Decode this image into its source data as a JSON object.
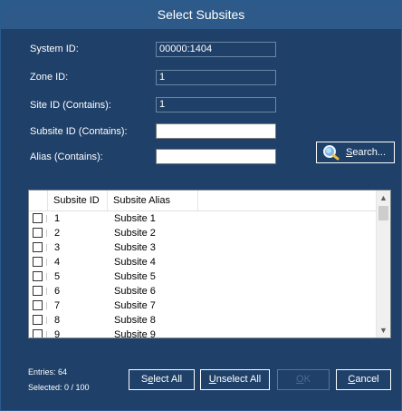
{
  "window": {
    "title": "Select Subsites"
  },
  "form": {
    "system_id": {
      "label": "System ID:",
      "value": "00000:1404"
    },
    "zone_id": {
      "label": "Zone ID:",
      "value": "1"
    },
    "site_id": {
      "label": "Site ID (Contains):",
      "value": "1"
    },
    "subsite_id": {
      "label": "Subsite ID (Contains):",
      "value": ""
    },
    "alias": {
      "label": "Alias (Contains):",
      "value": ""
    }
  },
  "search_button": {
    "label_prefix": "",
    "label_mnemonic": "S",
    "label_rest": "earch...",
    "icon": "magnifier-icon"
  },
  "list": {
    "columns": [
      "Subsite ID",
      "Subsite Alias"
    ],
    "rows": [
      {
        "id": "1",
        "alias": "Subsite 1",
        "checked": false
      },
      {
        "id": "2",
        "alias": "Subsite 2",
        "checked": false
      },
      {
        "id": "3",
        "alias": "Subsite 3",
        "checked": false
      },
      {
        "id": "4",
        "alias": "Subsite 4",
        "checked": false
      },
      {
        "id": "5",
        "alias": "Subsite 5",
        "checked": false
      },
      {
        "id": "6",
        "alias": "Subsite 6",
        "checked": false
      },
      {
        "id": "7",
        "alias": "Subsite 7",
        "checked": false
      },
      {
        "id": "8",
        "alias": "Subsite 8",
        "checked": false
      },
      {
        "id": "9",
        "alias": "Subsite 9",
        "checked": false
      }
    ]
  },
  "status": {
    "entries": "Entries: 64",
    "selected": "Selected: 0 / 100"
  },
  "buttons": {
    "select_all": {
      "pre": "S",
      "mn": "e",
      "post": "lect All"
    },
    "unselect_all": {
      "pre": "",
      "mn": "U",
      "post": "nselect All"
    },
    "ok": {
      "pre": "",
      "mn": "O",
      "post": "K",
      "disabled": true
    },
    "cancel": {
      "pre": "",
      "mn": "C",
      "post": "ancel"
    }
  },
  "colors": {
    "background": "#1f4068",
    "titlebar": "#2d5a88",
    "list_bg": "#ffffff"
  }
}
